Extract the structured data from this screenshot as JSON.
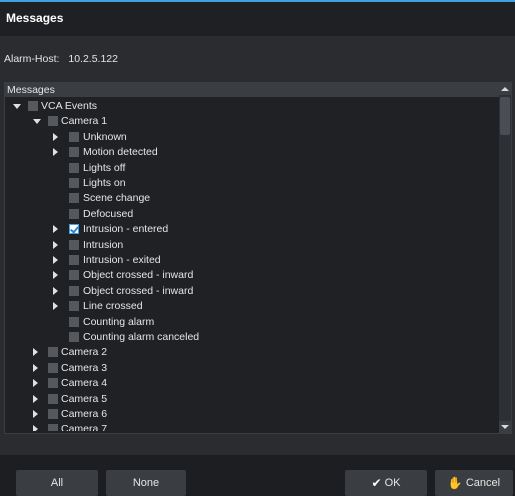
{
  "dialog": {
    "title": "Messages",
    "host_label": "Alarm-Host:",
    "host_value": "10.2.5.122",
    "panel_header": "Messages"
  },
  "tree": [
    {
      "label": "VCA Events",
      "depth": 0,
      "arrow": "expanded",
      "checked": false
    },
    {
      "label": "Camera 1",
      "depth": 1,
      "arrow": "expanded",
      "checked": false
    },
    {
      "label": "Unknown",
      "depth": 2,
      "arrow": "collapsed",
      "checked": false
    },
    {
      "label": "Motion detected",
      "depth": 2,
      "arrow": "collapsed",
      "checked": false
    },
    {
      "label": "Lights off",
      "depth": 2,
      "arrow": "none",
      "checked": false
    },
    {
      "label": "Lights on",
      "depth": 2,
      "arrow": "none",
      "checked": false
    },
    {
      "label": "Scene change",
      "depth": 2,
      "arrow": "none",
      "checked": false
    },
    {
      "label": "Defocused",
      "depth": 2,
      "arrow": "none",
      "checked": false
    },
    {
      "label": "Intrusion - entered",
      "depth": 2,
      "arrow": "collapsed",
      "checked": true
    },
    {
      "label": "Intrusion",
      "depth": 2,
      "arrow": "collapsed",
      "checked": false
    },
    {
      "label": "Intrusion - exited",
      "depth": 2,
      "arrow": "collapsed",
      "checked": false
    },
    {
      "label": "Object crossed - inward",
      "depth": 2,
      "arrow": "collapsed",
      "checked": false
    },
    {
      "label": "Object crossed - inward",
      "depth": 2,
      "arrow": "collapsed",
      "checked": false
    },
    {
      "label": "Line crossed",
      "depth": 2,
      "arrow": "collapsed",
      "checked": false
    },
    {
      "label": "Counting alarm",
      "depth": 2,
      "arrow": "none",
      "checked": false
    },
    {
      "label": "Counting alarm canceled",
      "depth": 2,
      "arrow": "none",
      "checked": false
    },
    {
      "label": "Camera 2",
      "depth": 1,
      "arrow": "collapsed",
      "checked": false
    },
    {
      "label": "Camera 3",
      "depth": 1,
      "arrow": "collapsed",
      "checked": false
    },
    {
      "label": "Camera 4",
      "depth": 1,
      "arrow": "collapsed",
      "checked": false
    },
    {
      "label": "Camera 5",
      "depth": 1,
      "arrow": "collapsed",
      "checked": false
    },
    {
      "label": "Camera 6",
      "depth": 1,
      "arrow": "collapsed",
      "checked": false
    },
    {
      "label": "Camera 7",
      "depth": 1,
      "arrow": "collapsed",
      "checked": false
    }
  ],
  "buttons": {
    "all": "All",
    "none": "None",
    "ok": "OK",
    "cancel": "Cancel"
  },
  "icons": {
    "ok": "checkmark-icon",
    "cancel": "hand-stop-icon"
  },
  "colors": {
    "accent": "#3fa1e0",
    "background": "#2a2c30"
  }
}
